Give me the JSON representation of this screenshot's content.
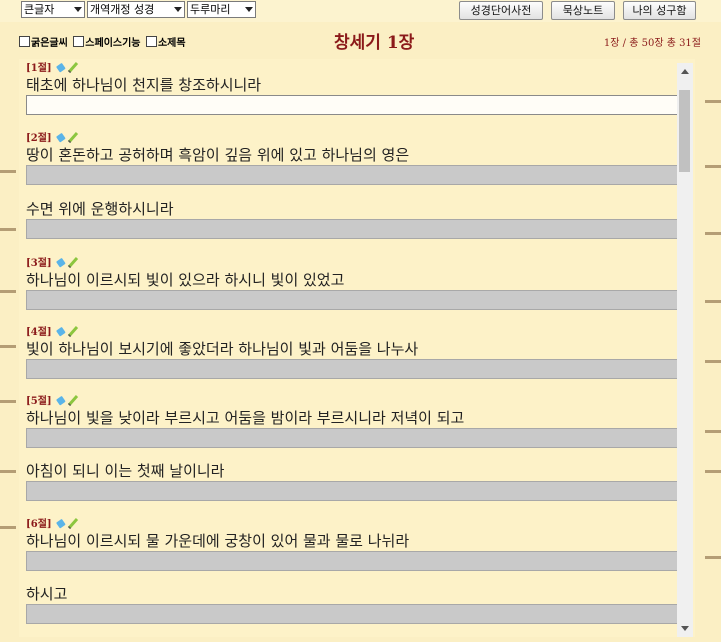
{
  "toolbar": {
    "font_size_select": "큰글자",
    "version_select": "개역개정 성경",
    "scroll_select": "두루마리",
    "dictionary_button": "성경단어사전",
    "meditation_button": "묵상노트",
    "my_verses_button": "나의 성구함"
  },
  "options": {
    "bold_label": "굵은글씨",
    "space_label": "스페이스기능",
    "subtitle_label": "소제목"
  },
  "header": {
    "title": "창세기 1장",
    "stats": "1장 / 총 50장  총 31절"
  },
  "verses": [
    {
      "label": "[1절]",
      "lines": [
        "태초에 하나님이 천지를 창조하시니라"
      ]
    },
    {
      "label": "[2절]",
      "lines": [
        "땅이 혼돈하고 공허하며 흑암이 깊음 위에 있고 하나님의 영은",
        "수면 위에 운행하시니라"
      ]
    },
    {
      "label": "[3절]",
      "lines": [
        "하나님이 이르시되 빛이 있으라 하시니 빛이 있었고"
      ]
    },
    {
      "label": "[4절]",
      "lines": [
        "빛이 하나님이 보시기에 좋았더라 하나님이 빛과 어둠을 나누사"
      ]
    },
    {
      "label": "[5절]",
      "lines": [
        "하나님이 빛을 낮이라 부르시고 어둠을 밤이라 부르시니라 저녁이 되고",
        "아침이 되니 이는 첫째 날이니라"
      ]
    },
    {
      "label": "[6절]",
      "lines": [
        "하나님이 이르시되 물 가운데에 궁창이 있어 물과 물로 나뉘라",
        "하시고"
      ]
    }
  ]
}
